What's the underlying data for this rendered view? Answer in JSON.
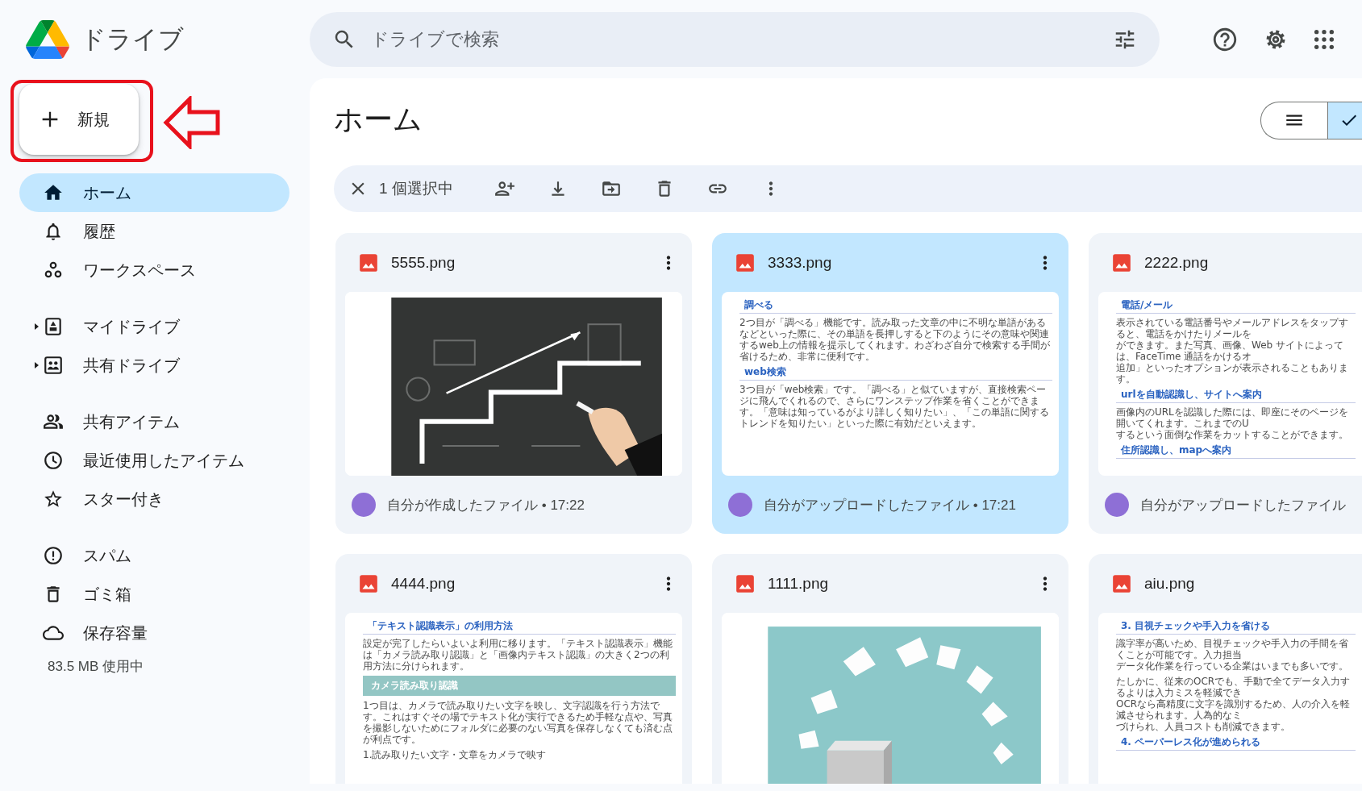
{
  "app": {
    "name": "ドライブ"
  },
  "search": {
    "placeholder": "ドライブで検索"
  },
  "sidebar": {
    "new_button": "新規",
    "annotations": [
      {
        "kind": "frame"
      },
      {
        "kind": "arrow"
      }
    ],
    "sections": [
      {
        "items": [
          {
            "label": "ホーム",
            "selected": true
          },
          {
            "label": "履歴",
            "selected": false
          },
          {
            "label": "ワークスペース",
            "selected": false
          }
        ]
      },
      {
        "items": [
          {
            "label": "マイドライブ",
            "selected": false,
            "expanded": false
          },
          {
            "label": "共有ドライブ",
            "selected": false,
            "expanded": false
          }
        ]
      },
      {
        "items": [
          {
            "label": "共有アイテム",
            "selected": false
          },
          {
            "label": "最近使用したアイテム",
            "selected": false
          },
          {
            "label": "スター付き",
            "selected": false
          }
        ]
      },
      {
        "items": [
          {
            "label": "スパム",
            "selected": false
          },
          {
            "label": "ゴミ箱",
            "selected": false
          },
          {
            "label": "保存容量",
            "selected": false
          }
        ]
      }
    ],
    "storage": "83.5 MB 使用中"
  },
  "page": {
    "title": "ホーム",
    "view_toggle": [
      {
        "selected": false
      },
      {
        "selected": true
      }
    ]
  },
  "selection_bar": {
    "count": "1 個選択中"
  },
  "files": [
    {
      "name": "5555.png",
      "selected": false,
      "owner_info": "自分が作成したファイル • 17:22"
    },
    {
      "name": "3333.png",
      "selected": true,
      "owner_info": "自分がアップロードしたファイル • 17:21",
      "thumbnail": {
        "kind": "document",
        "blocks": [
          {
            "kind": "heading",
            "text": "調べる"
          },
          {
            "kind": "paragraph",
            "lines": [
              "2つ目が「調べる」機能です。読み取った文章の中に不明な単語があるなどといった際に、その単語を長押しすると下のようにその意味や関連するweb上の情報を提示してくれます。わざわざ自分で検索する手間が省けるため、非常に便利です。"
            ]
          },
          {
            "kind": "heading",
            "text": "web検索"
          },
          {
            "kind": "paragraph",
            "lines": [
              "3つ目が「web検索」です。「調べる」と似ていますが、直接検索ページに飛んでくれるので、さらにワンステップ作業を省くことができます。「意味は知っているがより詳しく知りたい」、「この単語に関するトレンドを知りたい」といった際に有効だといえます。"
            ]
          }
        ]
      }
    },
    {
      "name": "2222.png",
      "selected": false,
      "owner_info": "自分がアップロードしたファイル",
      "thumbnail": {
        "kind": "document",
        "blocks": [
          {
            "kind": "heading",
            "text": "電話/メール"
          },
          {
            "kind": "paragraph",
            "lines": [
              "表示されている電話番号やメールアドレスをタップすると、電話をかけたりメールを",
              "ができます。また写真、画像、Web サイトによっては、FaceTime 通話をかけるオ",
              "追加」といったオプションが表示されることもあります。"
            ]
          },
          {
            "kind": "heading",
            "text": "urlを自動認識し、サイトへ案内"
          },
          {
            "kind": "paragraph",
            "lines": [
              "画像内のURLを認識した際には、即座にそのページを開いてくれます。これまでのU",
              "するという面倒な作業をカットすることができます。"
            ]
          },
          {
            "kind": "heading",
            "text": "住所認識し、mapへ案内"
          }
        ]
      }
    },
    {
      "name": "4444.png",
      "selected": false,
      "thumbnail": {
        "kind": "document",
        "blocks": [
          {
            "kind": "heading",
            "text": "「テキスト認識表示」の利用方法"
          },
          {
            "kind": "paragraph",
            "lines": [
              "設定が完了したらいよいよ利用に移ります。「テキスト認識表示」機能は「カメラ読み取り認識」と「画像内テキスト認識」の大きく2つの利用方法に分けられます。"
            ]
          },
          {
            "kind": "banner",
            "text": "カメラ読み取り認識"
          },
          {
            "kind": "paragraph",
            "lines": [
              "1つ目は、カメラで読み取りたい文字を映し、文字認識を行う方法です。これはすぐその場でテキスト化が実行できるため手軽な点や、写真を撮影しないためにフォルダに必要のない写真を保存しなくても済む点が利点です。"
            ]
          },
          {
            "kind": "paragraph",
            "lines": [
              "1.読み取りたい文字・文章をカメラで映す"
            ]
          }
        ]
      }
    },
    {
      "name": "1111.png",
      "selected": false
    },
    {
      "name": "aiu.png",
      "selected": false,
      "thumbnail": {
        "kind": "document",
        "blocks": [
          {
            "kind": "heading",
            "text": "3. 目視チェックや手入力を省ける"
          },
          {
            "kind": "paragraph",
            "lines": [
              "識字率が高いため、目視チェックや手入力の手間を省くことが可能です。入力担当",
              "データ化作業を行っている企業はいまでも多いです。"
            ]
          },
          {
            "kind": "paragraph",
            "lines": [
              "たしかに、従来のOCRでも、手動で全てデータ入力するよりは入力ミスを軽減でき",
              "OCRなら高精度に文字を識別するため、人の介入を軽減させられます。人為的なミ",
              "づけられ、人員コストも削減できます。"
            ]
          },
          {
            "kind": "heading",
            "text": "4. ペーパーレス化が進められる"
          }
        ]
      }
    }
  ]
}
